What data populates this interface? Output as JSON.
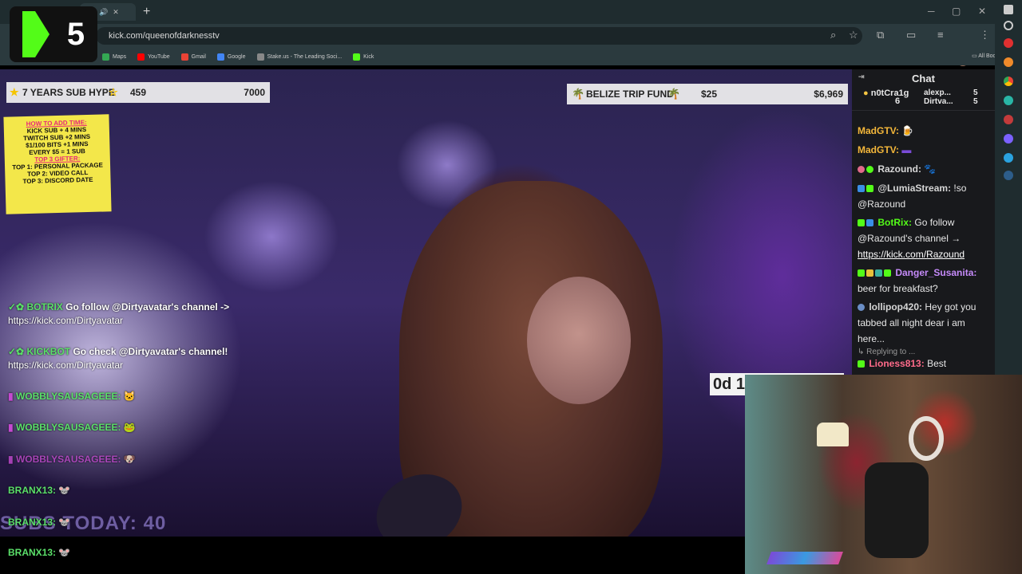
{
  "browser": {
    "tab_mute": "🔊",
    "tab_close": "✕",
    "new_tab": "+",
    "url": "kick.com/queenofdarknesstv",
    "bookmarks": [
      {
        "label": "Maps",
        "color": "#34a853"
      },
      {
        "label": "YouTube",
        "color": "#ff0000"
      },
      {
        "label": "Gmail",
        "color": "#ea4335"
      },
      {
        "label": "Google",
        "color": "#4285f4"
      },
      {
        "label": "Stake.us - The Leading Soci...",
        "color": "#888888"
      },
      {
        "label": "Kick",
        "color": "#53fc18"
      }
    ],
    "all_bookmarks": "All Bookmarks"
  },
  "logo": {
    "number": "5",
    "accent": "#53fc18"
  },
  "overlay": {
    "sub_hype": {
      "label": "7 YEARS SUB HYPE",
      "current": "459",
      "goal": "7000"
    },
    "trip_fund": {
      "label": "BELIZE TRIP FUND",
      "current": "$25",
      "goal": "$6,969"
    },
    "sign_lines": [
      {
        "text": "HOW TO ADD TIME:",
        "style": "r"
      },
      {
        "text": "KICK SUB + 4 MINS",
        "style": "k"
      },
      {
        "text": "TWITCH SUB +2 MINS",
        "style": "k"
      },
      {
        "text": "$1/100 BITS +1 MINS",
        "style": "k"
      },
      {
        "text": "EVERY $5 = 1 SUB",
        "style": "k"
      },
      {
        "text": "TOP 3 GIFTER:",
        "style": "r"
      },
      {
        "text": "TOP 1: PERSONAL PACKAGE",
        "style": "k"
      },
      {
        "text": "TOP 2: VIDEO CALL",
        "style": "k"
      },
      {
        "text": "TOP 3: DISCORD DATE",
        "style": "k"
      }
    ],
    "stream_chat": [
      {
        "name": "BOTRIX",
        "text": "Go follow @Dirtyavatar's channel ->",
        "link": "https://kick.com/Dirtyavatar"
      },
      {
        "name": "KICKBOT",
        "text": "Go check @Dirtyavatar's channel!",
        "link": "https://kick.com/Dirtyavatar"
      }
    ],
    "wobbly": [
      "WOBBLYSAUSAGEEE:",
      "WOBBLYSAUSAGEEE:",
      "WOBBLYSAUSAGEEE:"
    ],
    "branx": [
      "BRANX13:",
      "BRANX13:",
      "BRANX13:"
    ],
    "subs_today": "SUBS TODAY: 40",
    "timer": "0d 1"
  },
  "chat": {
    "title": "Chat",
    "pinned": [
      {
        "name": "n0tCra1g",
        "count": "6"
      },
      {
        "name": "alexp...",
        "count": "5"
      },
      {
        "name": "Dirtva...",
        "count": "5"
      }
    ],
    "messages": [
      {
        "user": "MadGTV:",
        "text": "",
        "color": "#f4b73a"
      },
      {
        "user": "MadGTV:",
        "text": "",
        "color": "#f4b73a"
      },
      {
        "user": "Razound:",
        "text": "",
        "color": "#d6d6d6"
      },
      {
        "user": "@LumiaStream:",
        "text": "!so @Razound",
        "color": "#d6d6d6"
      },
      {
        "user": "BotRix:",
        "text": "Go follow @Razound's channel →",
        "link": "https://kick.com/Razound",
        "color": "#53fc18"
      },
      {
        "user": "Danger_Susanita:",
        "text": "beer for breakfast?",
        "color": "#c58af9"
      },
      {
        "user": "lollipop420:",
        "text": "Hey got you tabbed all night dear i am here...",
        "color": "#d6d6d6"
      },
      {
        "user": "Lioness813:",
        "text": "Best",
        "color": "#ff6b8a"
      }
    ],
    "replying": "Replying to ..."
  }
}
